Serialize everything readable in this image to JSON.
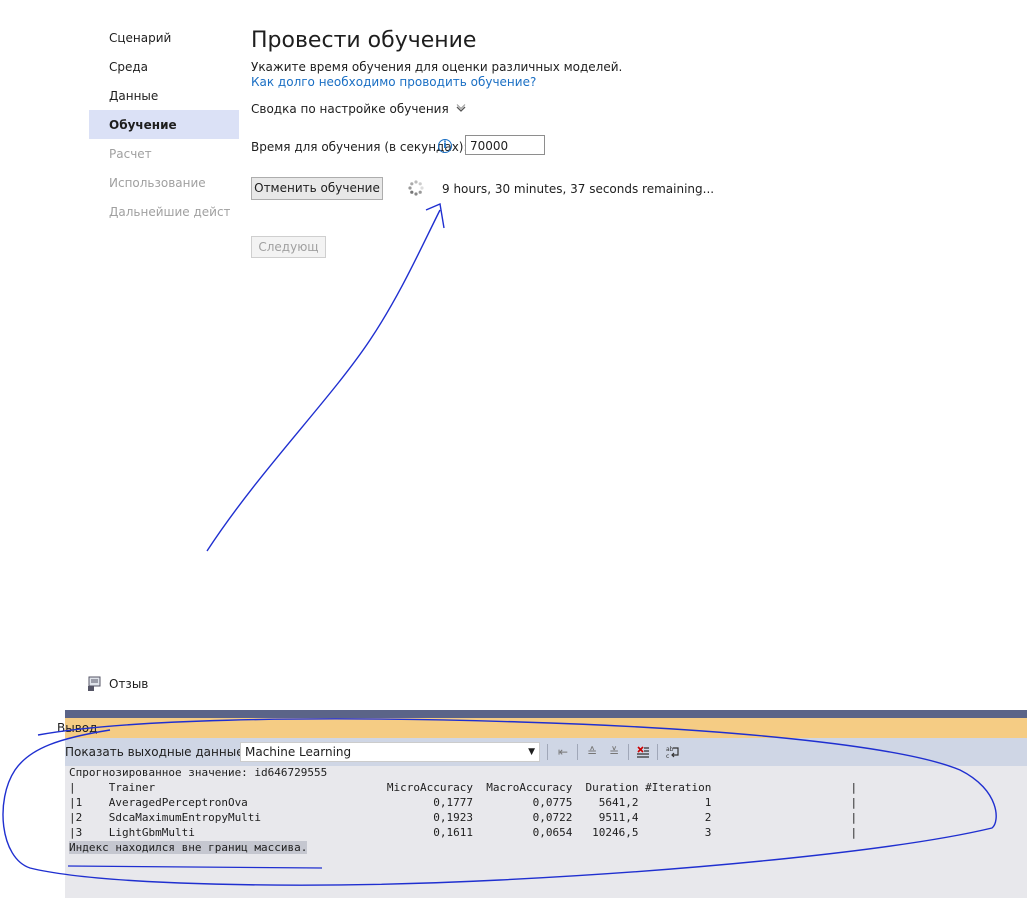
{
  "nav": {
    "items": [
      {
        "label": "Сценарий",
        "state": "normal"
      },
      {
        "label": "Среда",
        "state": "normal"
      },
      {
        "label": "Данные",
        "state": "normal"
      },
      {
        "label": "Обучение",
        "state": "active"
      },
      {
        "label": "Расчет",
        "state": "disabled"
      },
      {
        "label": "Использование",
        "state": "disabled"
      },
      {
        "label": "Дальнейшие действия",
        "state": "disabled"
      }
    ]
  },
  "main": {
    "title": "Провести обучение",
    "description": "Укажите время обучения для оценки различных моделей.",
    "help_link": "Как долго необходимо проводить обучение?",
    "summary_label": "Сводка по настройке обучения",
    "time_label": "Время для обучения (в секундах):",
    "time_value": "70000",
    "cancel_label": "Отменить обучение",
    "remaining_text": "9 hours, 30 minutes, 37 seconds remaining...",
    "next_label": "Следующ"
  },
  "feedback": {
    "label": "Отзыв"
  },
  "output_panel": {
    "title": "Вывод",
    "show_label": "Показать выходные данные из:",
    "source_value": "Machine Learning",
    "lines": [
      "Спрогнозированное значение: id646729555",
      "|     Trainer                                   MicroAccuracy  MacroAccuracy  Duration #Iteration                     |",
      "|1    AveragedPerceptronOva                            0,1777         0,0775    5641,2          1                     |",
      "|2    SdcaMaximumEntropyMulti                          0,1923         0,0722    9511,4          2                     |",
      "|3    LightGbmMulti                                    0,1611         0,0654   10246,5          3                     |"
    ],
    "error_line": "Индекс находился вне границ массива."
  },
  "colors": {
    "accent": "#1a6fc4",
    "nav_active_bg": "#dbe1f6",
    "panel_header_bg": "#f5cc84",
    "annotation_ink": "#1f2fd0"
  }
}
